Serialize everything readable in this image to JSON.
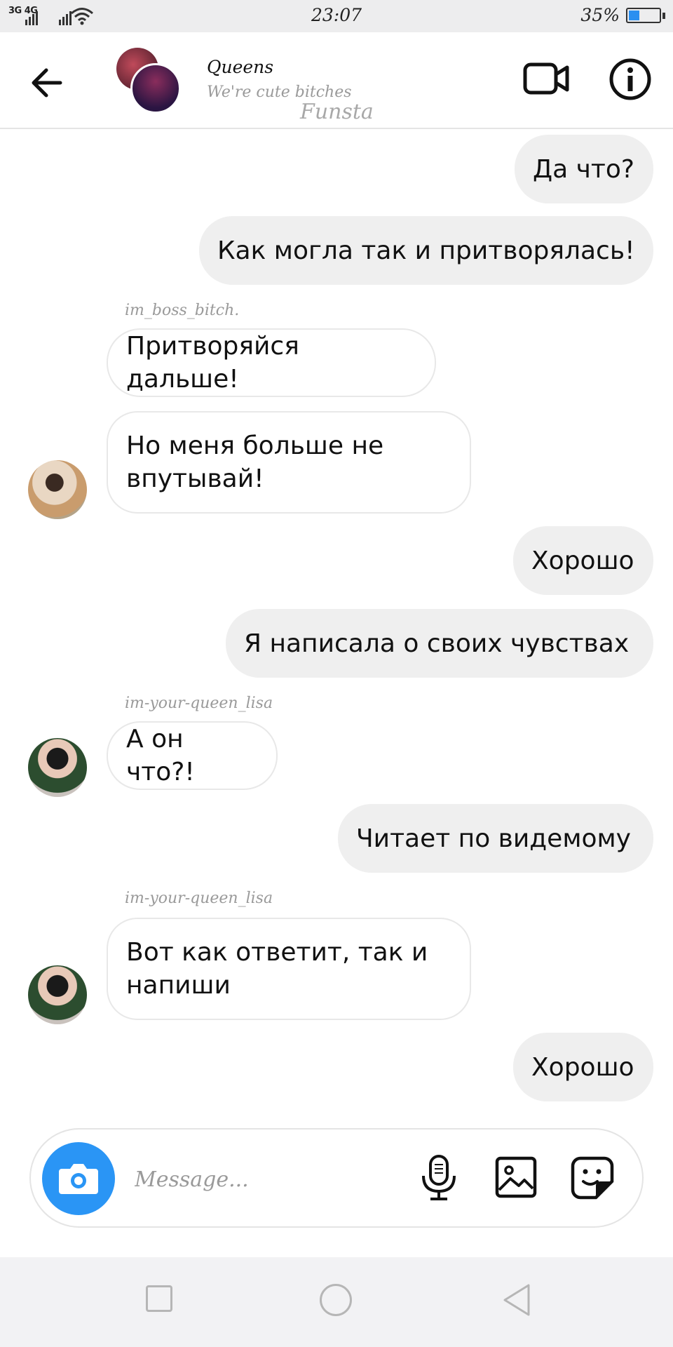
{
  "status_bar": {
    "network": "3G 4G",
    "time": "23:07",
    "battery_percent": "35%",
    "battery_level": 0.35,
    "icons": [
      "signal-icon",
      "wifi-icon",
      "battery-icon"
    ]
  },
  "header": {
    "title": "Queens",
    "subtitle": "We're cute bitches",
    "watermark": "Funsta",
    "icons": [
      "back-arrow-icon",
      "video-call-icon",
      "info-icon"
    ]
  },
  "messages": [
    {
      "direction": "out",
      "text": "Да что?"
    },
    {
      "direction": "out",
      "text": "Как могла так и притворялась!"
    },
    {
      "direction": "in",
      "sender": "im_boss_bitch.",
      "text": "Притворяйся дальше!"
    },
    {
      "direction": "in",
      "text": "Но меня больше не впутывай!"
    },
    {
      "direction": "out",
      "text": "Хорошо"
    },
    {
      "direction": "out",
      "text": "Я написала о своих чувствах"
    },
    {
      "direction": "in",
      "sender": "im-your-queen_lisa",
      "text": "А он что?!"
    },
    {
      "direction": "out",
      "text": "Читает по видемому"
    },
    {
      "direction": "in",
      "sender": "im-your-queen_lisa",
      "text": "Вот как ответит, так и напиши"
    },
    {
      "direction": "out",
      "text": "Хорошо"
    }
  ],
  "composer": {
    "placeholder": "Message...",
    "icons": [
      "camera-icon",
      "microphone-icon",
      "gallery-icon",
      "sticker-icon"
    ]
  },
  "colors": {
    "accent": "#2a95f5",
    "outgoing_bubble": "#efefef",
    "incoming_border": "#e8e8e8",
    "muted_text": "#9a9a9a"
  },
  "nav_bar": {
    "icons": [
      "recent-apps-icon",
      "home-icon",
      "back-icon"
    ]
  }
}
